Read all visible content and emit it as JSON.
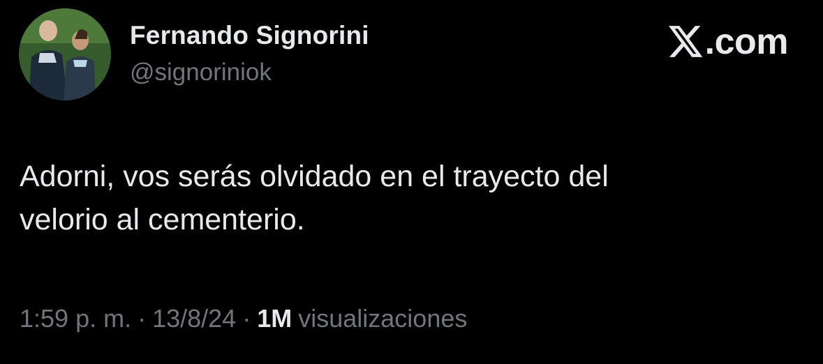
{
  "author": {
    "name": "Fernando Signorini",
    "handle": "@signoriniok",
    "avatar_icon": "profile-photo-avatar"
  },
  "brand": {
    "icon": "x-logo-icon",
    "text": ".com"
  },
  "tweet": {
    "lines": [
      "Adorni, vos serás olvidado en el trayecto del",
      "velorio al cementerio."
    ]
  },
  "meta": {
    "time": "1:59 p. m.",
    "separator": "·",
    "date": "13/8/24",
    "views_count": "1M",
    "views_label": "visualizaciones"
  },
  "colors": {
    "background": "#000000",
    "primary_text": "#e7e9ea",
    "secondary_text": "#71767b"
  }
}
